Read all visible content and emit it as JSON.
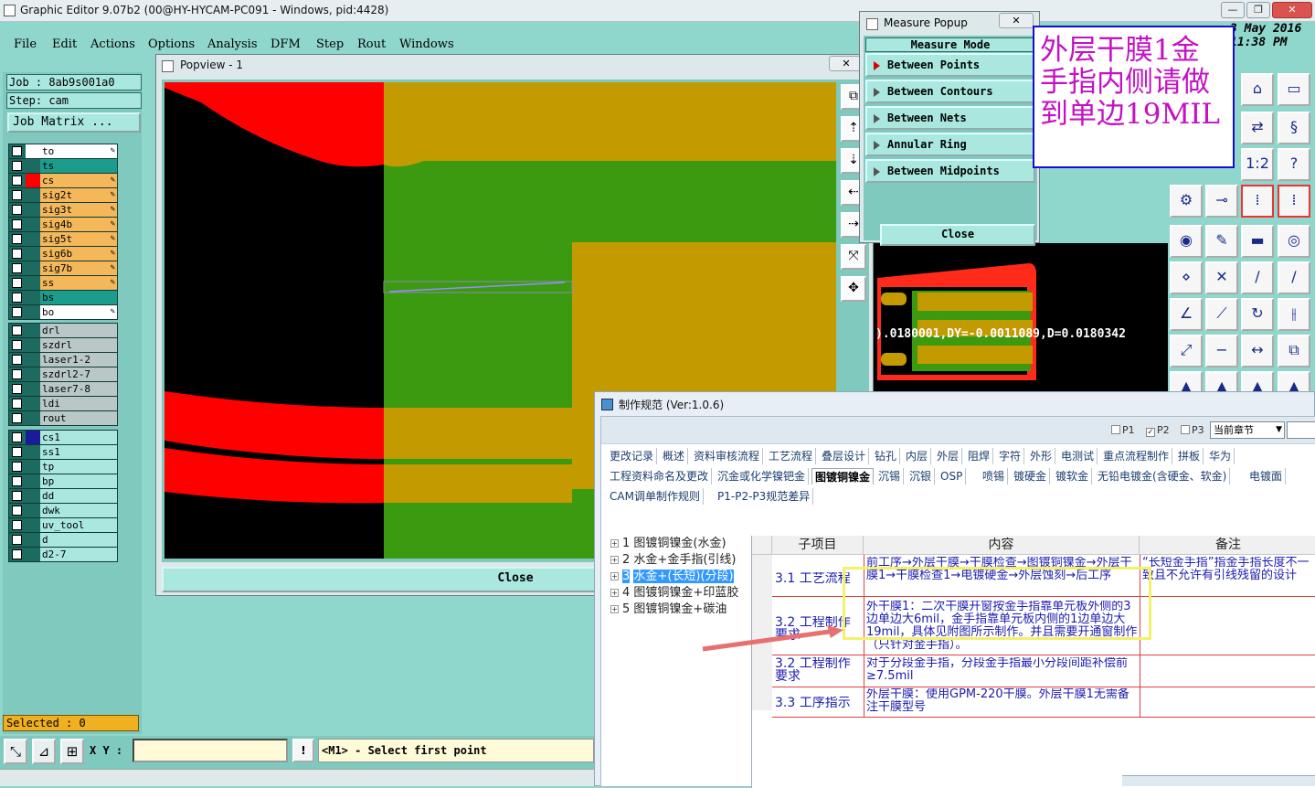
{
  "window": {
    "title": "Graphic Editor 9.07b2 (00@HY-HYCAM-PC091 - Windows, pid:4428)",
    "minimize": "—",
    "restore": "❐",
    "close": "✕"
  },
  "menu": [
    "File",
    "Edit",
    "Actions",
    "Options",
    "Analysis",
    "DFM",
    "Step",
    "Rout",
    "Windows"
  ],
  "job": {
    "job_line": "Job : 8ab9s001a0",
    "step_line": "Step: cam",
    "matrix_button": "Job Matrix ..."
  },
  "layers_group1": [
    {
      "name": "to",
      "color": "#ffffff",
      "bg": "#ffffff",
      "pen": true
    },
    {
      "name": "ts",
      "color": "#1c6a60",
      "bg": "#1c9c8c",
      "pen": false
    },
    {
      "name": "cs",
      "color": "#ff0000",
      "bg": "#f4b85a",
      "pen": true
    },
    {
      "name": "sig2t",
      "color": "#1c6a60",
      "bg": "#f4b85a",
      "pen": true
    },
    {
      "name": "sig3t",
      "color": "#1c6a60",
      "bg": "#f4b85a",
      "pen": true
    },
    {
      "name": "sig4b",
      "color": "#1c6a60",
      "bg": "#f4b85a",
      "pen": true
    },
    {
      "name": "sig5t",
      "color": "#1c6a60",
      "bg": "#f4b85a",
      "pen": true
    },
    {
      "name": "sig6b",
      "color": "#1c6a60",
      "bg": "#f4b85a",
      "pen": true
    },
    {
      "name": "sig7b",
      "color": "#1c6a60",
      "bg": "#f4b85a",
      "pen": true
    },
    {
      "name": "ss",
      "color": "#1c6a60",
      "bg": "#f4b85a",
      "pen": true
    },
    {
      "name": "bs",
      "color": "#1c6a60",
      "bg": "#1c9c8c",
      "pen": false
    },
    {
      "name": "bo",
      "color": "#1c6a60",
      "bg": "#ffffff",
      "pen": true
    }
  ],
  "layers_group2": [
    "drl",
    "szdrl",
    "laser1-2",
    "szdrl2-7",
    "laser7-8",
    "ldi",
    "rout"
  ],
  "layers_group3": [
    "cs1",
    "ss1",
    "tp",
    "bp",
    "dd",
    "dwk",
    "uv_tool",
    "d",
    "d2-7"
  ],
  "selected_text": "Selected : 0",
  "status": {
    "xy_label": "X Y :",
    "xy_value": "",
    "alert": "!",
    "prompt": "<M1> - Select first point"
  },
  "popview": {
    "title": "Popview - 1",
    "close_x": "✕",
    "close_button": "Close",
    "colors": {
      "red": "#ff0000",
      "gold": "#c39a00",
      "green": "#3c9a10",
      "black": "#000000"
    }
  },
  "measure": {
    "title": "Measure Popup",
    "close_x": "✕",
    "mode_header": "Measure Mode",
    "items": [
      "Between Points",
      "Between Contours",
      "Between Nets",
      "Annular Ring",
      "Between Midpoints"
    ],
    "close_button": "Close"
  },
  "annotation": "外层干膜1金手指内侧请做到单边19MIL",
  "date": {
    "line1": "3 May 2016",
    "line2": "11:38 PM"
  },
  "measure_readout": ").0180001,DY=-0.0011089,D=0.0180342",
  "spec": {
    "title": "制作规范 (Ver:1.0.6)",
    "checks": [
      "P1",
      "P2",
      "P3"
    ],
    "check_states": [
      false,
      true,
      false
    ],
    "dropdown": "当前章节",
    "tabs_row1": [
      "更改记录",
      "概述",
      "资料审核流程",
      "工艺流程",
      "叠层设计",
      "钻孔",
      "内层",
      "外层",
      "阻焊",
      "字符",
      "外形",
      "电测试",
      "重点流程制作",
      "拼板",
      "华为"
    ],
    "tabs_row2": [
      "工程资料命名及更改",
      "沉金或化学镍钯金",
      "图镀铜镍金",
      "沉锡",
      "沉银",
      "OSP",
      "喷锡",
      "镀硬金",
      "镀软金",
      "无铅电镀金(含硬金、软金)",
      "电镀面"
    ],
    "tabs_row3": [
      "CAM调单制作规则",
      "P1-P2-P3规范差异"
    ],
    "tree": [
      {
        "num": "1",
        "text": "图镀铜镍金(水金)"
      },
      {
        "num": "2",
        "text": "水金+金手指(引线)"
      },
      {
        "num": "3",
        "text": "水金+(长短)(分段)"
      },
      {
        "num": "4",
        "text": "图镀铜镍金+印蓝胶"
      },
      {
        "num": "5",
        "text": "图镀铜镍金+碳油"
      }
    ],
    "columns": [
      "子项目",
      "内容",
      "备注"
    ],
    "rows": [
      {
        "cat": "3.1 工艺流程",
        "content": "前工序→外层干膜→干膜检查→图镀铜镍金→外层干膜1→干膜检查1→电镀硬金→外层蚀刻→后工序",
        "note": "“长短金手指”指金手指长度不一致且不允许有引线残留的设计"
      },
      {
        "cat": "3.2 工程制作要求",
        "content": "外干膜1：二次干膜开窗按金手指靠单元板外侧的3边单边大6mil，金手指靠单元板内侧的1边单边大19mil，具体见附图所示制作。并且需要开通窗制作（只针对金手指）。",
        "note": ""
      },
      {
        "cat": "3.2 工程制作要求",
        "content": "对于分段金手指，分段金手指最小分段间距补偿前≥7.5mil",
        "note": ""
      },
      {
        "cat": "3.3 工序指示",
        "content": "外层干膜：使用GPM-220干膜。外层干膜1无需备注干膜型号",
        "note": ""
      }
    ]
  }
}
